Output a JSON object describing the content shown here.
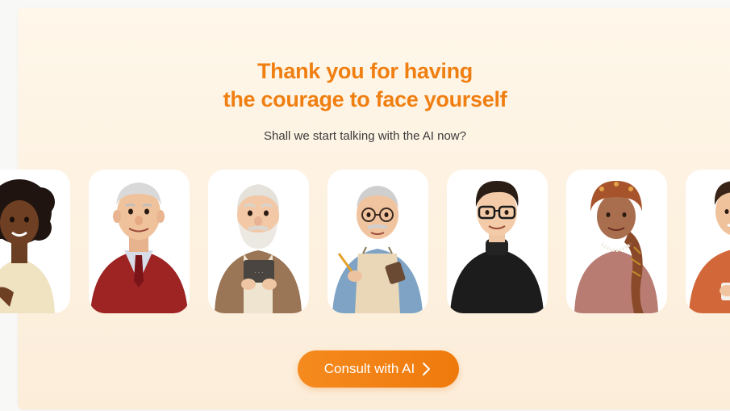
{
  "hero": {
    "title_line1": "Thank you for having",
    "title_line2": "the courage to face yourself",
    "subtitle": "Shall we start talking with the AI now?"
  },
  "avatars": [
    {
      "name": "woman-curly-hair-avatar"
    },
    {
      "name": "elderly-man-red-cardigan-avatar"
    },
    {
      "name": "bearded-elder-with-book-avatar"
    },
    {
      "name": "elder-man-glasses-apron-avatar"
    },
    {
      "name": "young-man-glasses-black-sweater-avatar"
    },
    {
      "name": "elderly-woman-headscarf-avatar"
    },
    {
      "name": "man-orange-hoodie-avatar"
    }
  ],
  "cta": {
    "label": "Consult with AI",
    "icon": "chevron-right-icon"
  },
  "colors": {
    "accent": "#f07f12",
    "background": "#fff7ea",
    "card": "#ffffff"
  }
}
